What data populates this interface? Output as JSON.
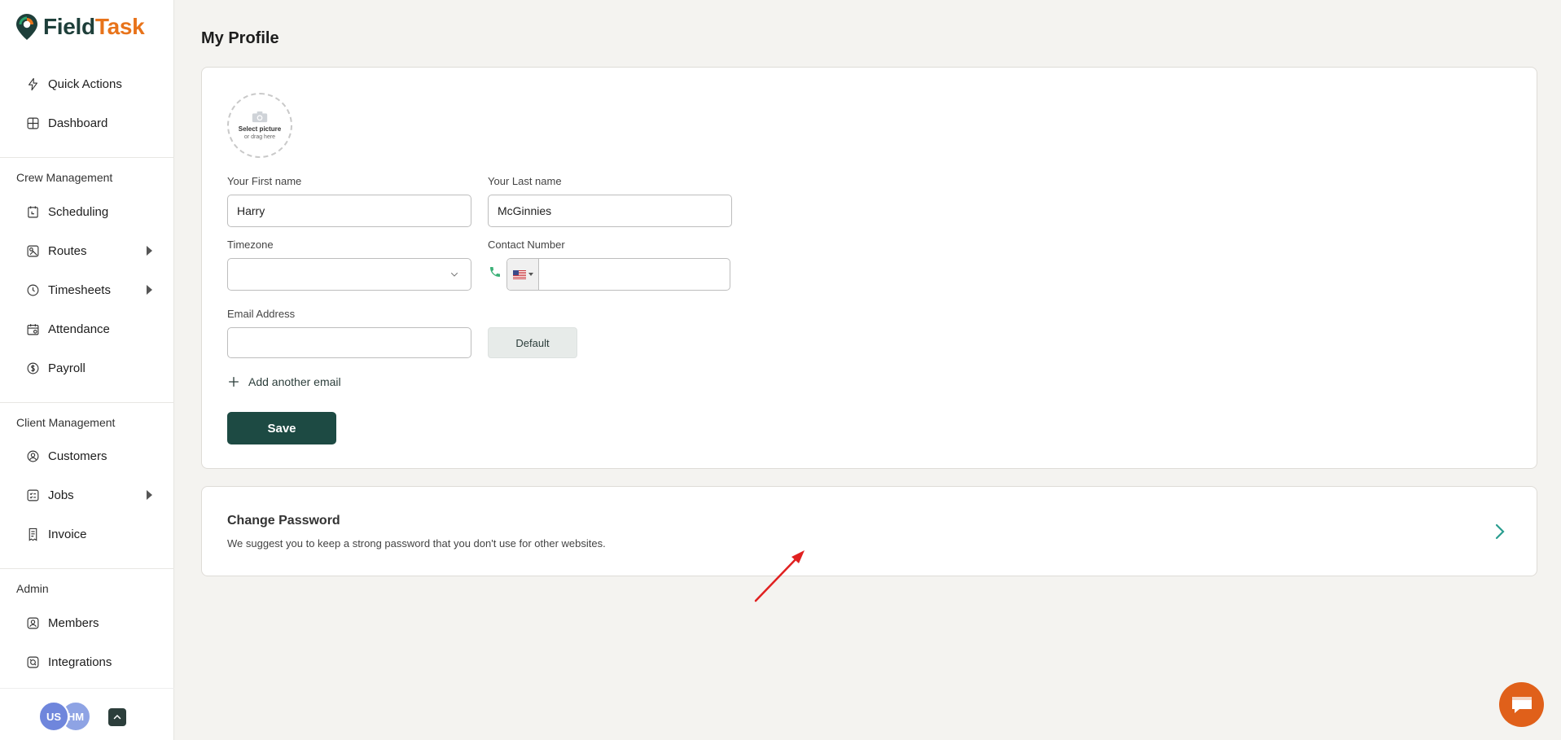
{
  "brand": {
    "name_part1": "Field",
    "name_part2": "Task",
    "color_primary": "#1e3f3a",
    "color_accent": "#e8731a"
  },
  "sidebar": {
    "top_items": [
      {
        "label": "Quick Actions",
        "icon": "bolt-icon"
      },
      {
        "label": "Dashboard",
        "icon": "dashboard-icon"
      }
    ],
    "sections": [
      {
        "title": "Crew Management",
        "items": [
          {
            "label": "Scheduling",
            "icon": "schedule-icon",
            "expandable": false
          },
          {
            "label": "Routes",
            "icon": "routes-icon",
            "expandable": true
          },
          {
            "label": "Timesheets",
            "icon": "clock-icon",
            "expandable": true
          },
          {
            "label": "Attendance",
            "icon": "calendar-icon",
            "expandable": false
          },
          {
            "label": "Payroll",
            "icon": "dollar-icon",
            "expandable": false
          }
        ]
      },
      {
        "title": "Client Management",
        "items": [
          {
            "label": "Customers",
            "icon": "customer-icon",
            "expandable": false
          },
          {
            "label": "Jobs",
            "icon": "jobs-icon",
            "expandable": true
          },
          {
            "label": "Invoice",
            "icon": "invoice-icon",
            "expandable": false
          }
        ]
      },
      {
        "title": "Admin",
        "items": [
          {
            "label": "Members",
            "icon": "members-icon",
            "expandable": false
          },
          {
            "label": "Integrations",
            "icon": "integrations-icon",
            "expandable": false
          }
        ]
      }
    ],
    "footer": {
      "avatar1": "US",
      "avatar2": "HM"
    }
  },
  "page": {
    "title": "My Profile"
  },
  "profile": {
    "picture": {
      "line1": "Select picture",
      "line2": "or drag here"
    },
    "first_name": {
      "label": "Your First name",
      "value": "Harry"
    },
    "last_name": {
      "label": "Your Last name",
      "value": "McGinnies"
    },
    "timezone": {
      "label": "Timezone",
      "value": ""
    },
    "contact": {
      "label": "Contact Number",
      "value": ""
    },
    "email": {
      "label": "Email Address",
      "value": "",
      "default_label": "Default"
    },
    "add_email_label": "Add another email",
    "save_label": "Save"
  },
  "password": {
    "title": "Change Password",
    "subtitle": "We suggest you to keep a strong password that you don't use for other websites."
  }
}
